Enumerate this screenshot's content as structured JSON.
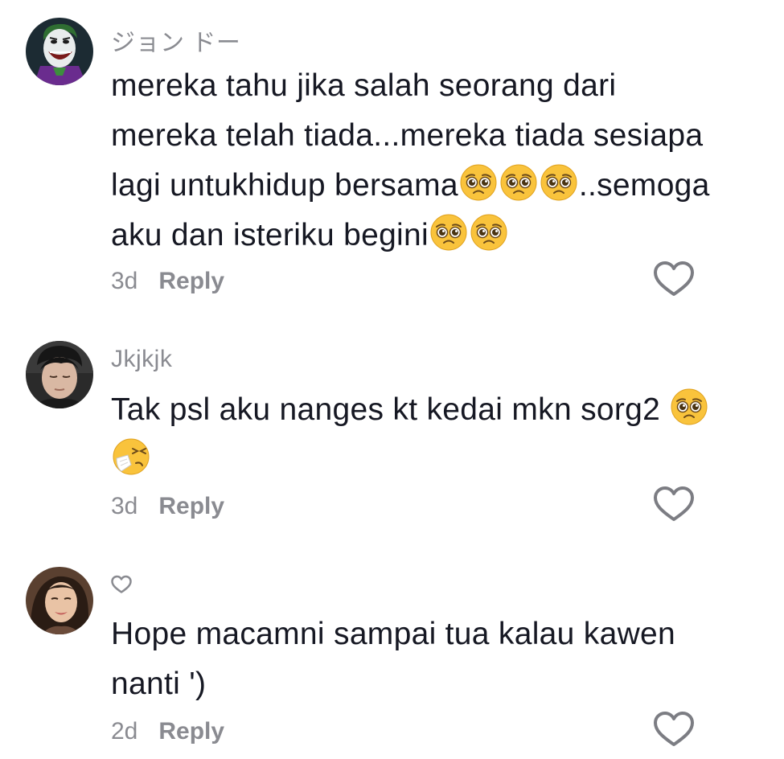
{
  "comments": [
    {
      "username": "ジョン ドー",
      "avatar_icon": "joker-cartoon-avatar",
      "lines": [
        "mereka tahu jika salah seorang dari",
        "mereka telah tiada...mereka tiada sesiapa",
        "lagi untukhidup bersama",
        "..semoga",
        "aku dan isteriku begini"
      ],
      "time": "3d",
      "reply_label": "Reply"
    },
    {
      "username": "Jkjkjk",
      "avatar_icon": "person-photo-avatar",
      "lines": [
        "Tak psl aku nanges kt kedai mkn sorg2 "
      ],
      "time": "3d",
      "reply_label": "Reply"
    },
    {
      "username": "",
      "avatar_icon": "girl-photo-avatar",
      "lines": [
        "Hope macamni sampai tua kalau kawen",
        "nanti ')"
      ],
      "time": "2d",
      "reply_label": "Reply"
    }
  ],
  "icons": {
    "like": "heart-outline-icon",
    "pleading": "pleading-face-emoji",
    "sneezing": "sneezing-face-emoji"
  },
  "colors": {
    "text": "#161823",
    "muted": "#8a8b91",
    "emoji_yellow": "#f8c23b"
  }
}
